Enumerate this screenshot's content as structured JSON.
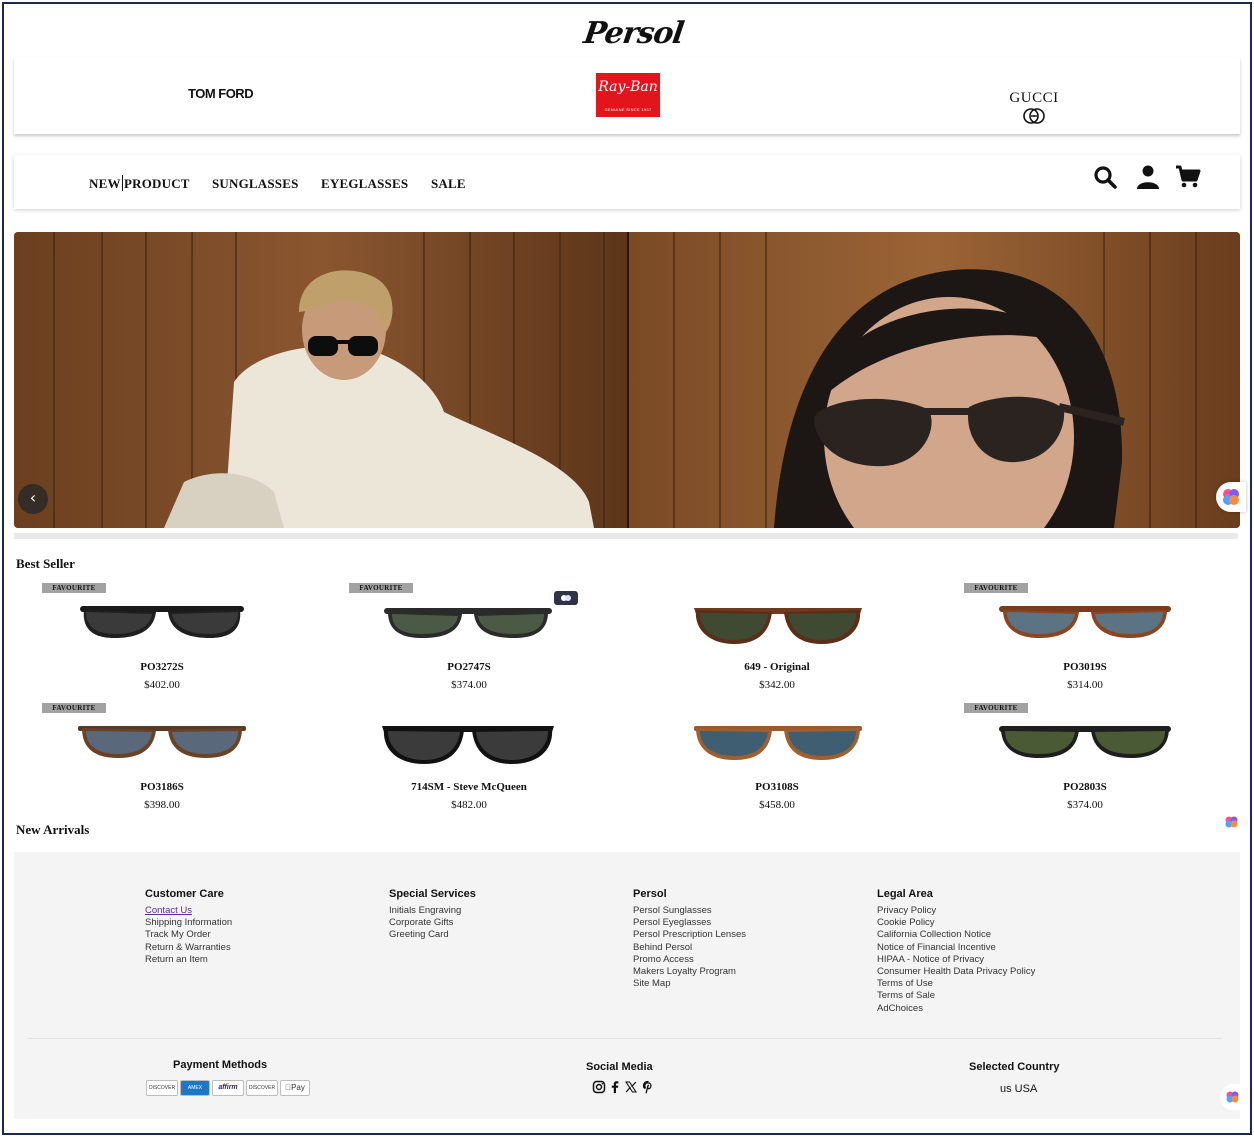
{
  "header": {
    "logo_persol": "Persol",
    "brands": {
      "tomford": "TOM FORD",
      "rayban": "Ray-Ban",
      "rayban_sub": "GENUINE SINCE 1937",
      "gucci": "GUCCI"
    }
  },
  "nav": {
    "items": [
      "NEW",
      "PRODUCT",
      "SUNGLASSES",
      "EYEGLASSES",
      "SALE"
    ],
    "icons": [
      "search-icon",
      "account-icon",
      "cart-icon"
    ]
  },
  "hero": {
    "prev_label": "‹"
  },
  "best_seller": {
    "title": "Best Seller",
    "badge_label": "FAVOURITE",
    "products": [
      {
        "name": "PO3272S",
        "price": "$402.00",
        "favourite": true
      },
      {
        "name": "PO2747S",
        "price": "$374.00",
        "favourite": true
      },
      {
        "name": "649 - Original",
        "price": "$342.00",
        "favourite": false
      },
      {
        "name": "PO3019S",
        "price": "$314.00",
        "favourite": true
      },
      {
        "name": "PO3186S",
        "price": "$398.00",
        "favourite": true
      },
      {
        "name": "714SM - Steve McQueen",
        "price": "$482.00",
        "favourite": false
      },
      {
        "name": "PO3108S",
        "price": "$458.00",
        "favourite": false
      },
      {
        "name": "PO2803S",
        "price": "$374.00",
        "favourite": true
      }
    ]
  },
  "new_arrivals": {
    "title": "New Arrivals"
  },
  "footer": {
    "customer_care": {
      "title": "Customer Care",
      "links": [
        "Contact Us",
        "Shipping Information",
        "Track My Order",
        "Return & Warranties",
        "Return an Item"
      ]
    },
    "special_services": {
      "title": "Special Services",
      "links": [
        "Initials Engraving",
        "Corporate Gifts",
        "Greeting Card"
      ]
    },
    "persol": {
      "title": "Persol",
      "links": [
        "Persol Sunglasses",
        "Persol Eyeglasses",
        "Persol Prescription Lenses",
        "Behind Persol",
        "Promo Access",
        "Makers Loyalty Program",
        "Site Map"
      ]
    },
    "legal": {
      "title": "Legal Area",
      "links": [
        "Privacy Policy",
        "Cookie Policy",
        "California Collection Notice",
        "Notice of Financial Incentive",
        "HIPAA - Notice of Privacy",
        "Consumer Health Data Privacy Policy",
        "Terms of Use",
        "Terms of Sale",
        "AdChoices"
      ]
    },
    "payment": {
      "title": "Payment Methods",
      "cards": [
        "DISCOVER",
        "AMEX",
        "affirm",
        "DISCOVER",
        "Pay"
      ]
    },
    "social": {
      "title": "Social Media",
      "icons": [
        "instagram-icon",
        "facebook-icon",
        "x-icon",
        "pinterest-icon"
      ]
    },
    "country": {
      "title": "Selected Country",
      "value": "us USA"
    }
  },
  "colors": {
    "frame": "#1b2a4a",
    "footer_bg": "#f4f4f4",
    "badge_bg": "#a2a2a2",
    "rayban_red": "#e3141c",
    "active_link": "#5a2d91"
  }
}
